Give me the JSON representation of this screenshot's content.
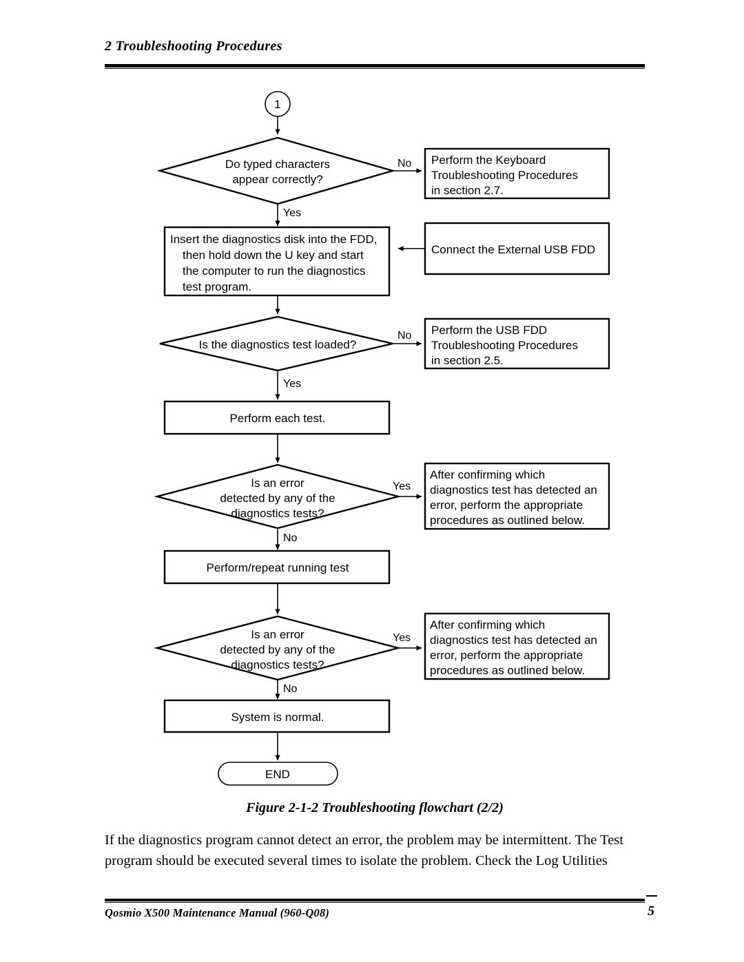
{
  "header": {
    "title": "2 Troubleshooting Procedures"
  },
  "figure": {
    "caption": "Figure 2-1-2 Troubleshooting flowchart (2/2)",
    "connector_in": "1",
    "nodes": {
      "decision1": {
        "line1": "Do typed characters",
        "line2": "appear correctly?"
      },
      "keyboard_box": {
        "line1": "Perform the Keyboard",
        "line2": "Troubleshooting Procedures",
        "line3": "in section 2.7."
      },
      "insert_disk_box": {
        "line1": "Insert the diagnostics disk into the FDD,",
        "line2": "then hold down the U key and start",
        "line3": "the computer to run the diagnostics",
        "line4": "test program."
      },
      "connect_fdd_box": {
        "line1": "Connect the External USB FDD"
      },
      "decision2": {
        "line1": "Is the diagnostics test loaded?"
      },
      "usb_fdd_box": {
        "line1": "Perform the USB FDD",
        "line2": "Troubleshooting Procedures",
        "line3": "in section 2.5."
      },
      "perform_each_test_box": {
        "line1": "Perform each test."
      },
      "decision3": {
        "line1": "Is an error",
        "line2": "detected by any of the",
        "line3": "diagnostics tests?"
      },
      "after_confirming_box_1": {
        "line1": "After confirming which",
        "line2": "diagnostics test has detected an",
        "line3": "error, perform the appropriate",
        "line4": "procedures as outlined below."
      },
      "repeat_running_test_box": {
        "line1": "Perform/repeat running test"
      },
      "decision4": {
        "line1": "Is an error",
        "line2": "detected by any of the",
        "line3": "diagnostics tests?"
      },
      "after_confirming_box_2": {
        "line1": "After confirming which",
        "line2": "diagnostics test has detected an",
        "line3": "error, perform the appropriate",
        "line4": "procedures as outlined below."
      },
      "system_normal_box": {
        "line1": "System is normal."
      },
      "end_terminator": {
        "line1": "END"
      }
    },
    "edge_labels": {
      "d1_no": "No",
      "d1_yes": "Yes",
      "d2_no": "No",
      "d2_yes": "Yes",
      "d3_yes": "Yes",
      "d3_no": "No",
      "d4_yes": "Yes",
      "d4_no": "No"
    }
  },
  "body": {
    "paragraph": "If the diagnostics program cannot detect an error, the problem may be intermittent. The Test program should be executed several times to isolate the problem. Check the Log Utilities"
  },
  "footer": {
    "manual": "Qosmio X500 Maintenance Manual (960-Q08)",
    "page_number": "5"
  }
}
